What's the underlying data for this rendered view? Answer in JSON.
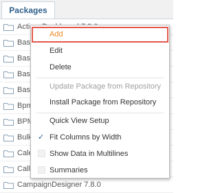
{
  "tab": {
    "label": "Packages"
  },
  "packages": [
    "ActionsDashboard 7.8.0",
    "Base",
    "Base",
    "Base",
    "Base",
    "Bpm",
    "BPM",
    "Bulk",
    "Cale",
    "Call",
    "CampaignDesigner 7.8.0"
  ],
  "menu": {
    "add": "Add",
    "edit": "Edit",
    "delete": "Delete",
    "update_from_repo": "Update Package from Repository",
    "install_from_repo": "Install Package from Repository",
    "quick_view_setup": "Quick View Setup",
    "fit_columns": "Fit Columns by Width",
    "fit_columns_checked": true,
    "show_multilines": "Show Data in Multilines",
    "show_multilines_checked": false,
    "summaries": "Summaries",
    "summaries_checked": false
  },
  "colors": {
    "highlight_border": "#e2574c",
    "highlight_text": "#f08a24",
    "tab_text": "#2e5f8a",
    "folder": "#8aa1b6"
  }
}
